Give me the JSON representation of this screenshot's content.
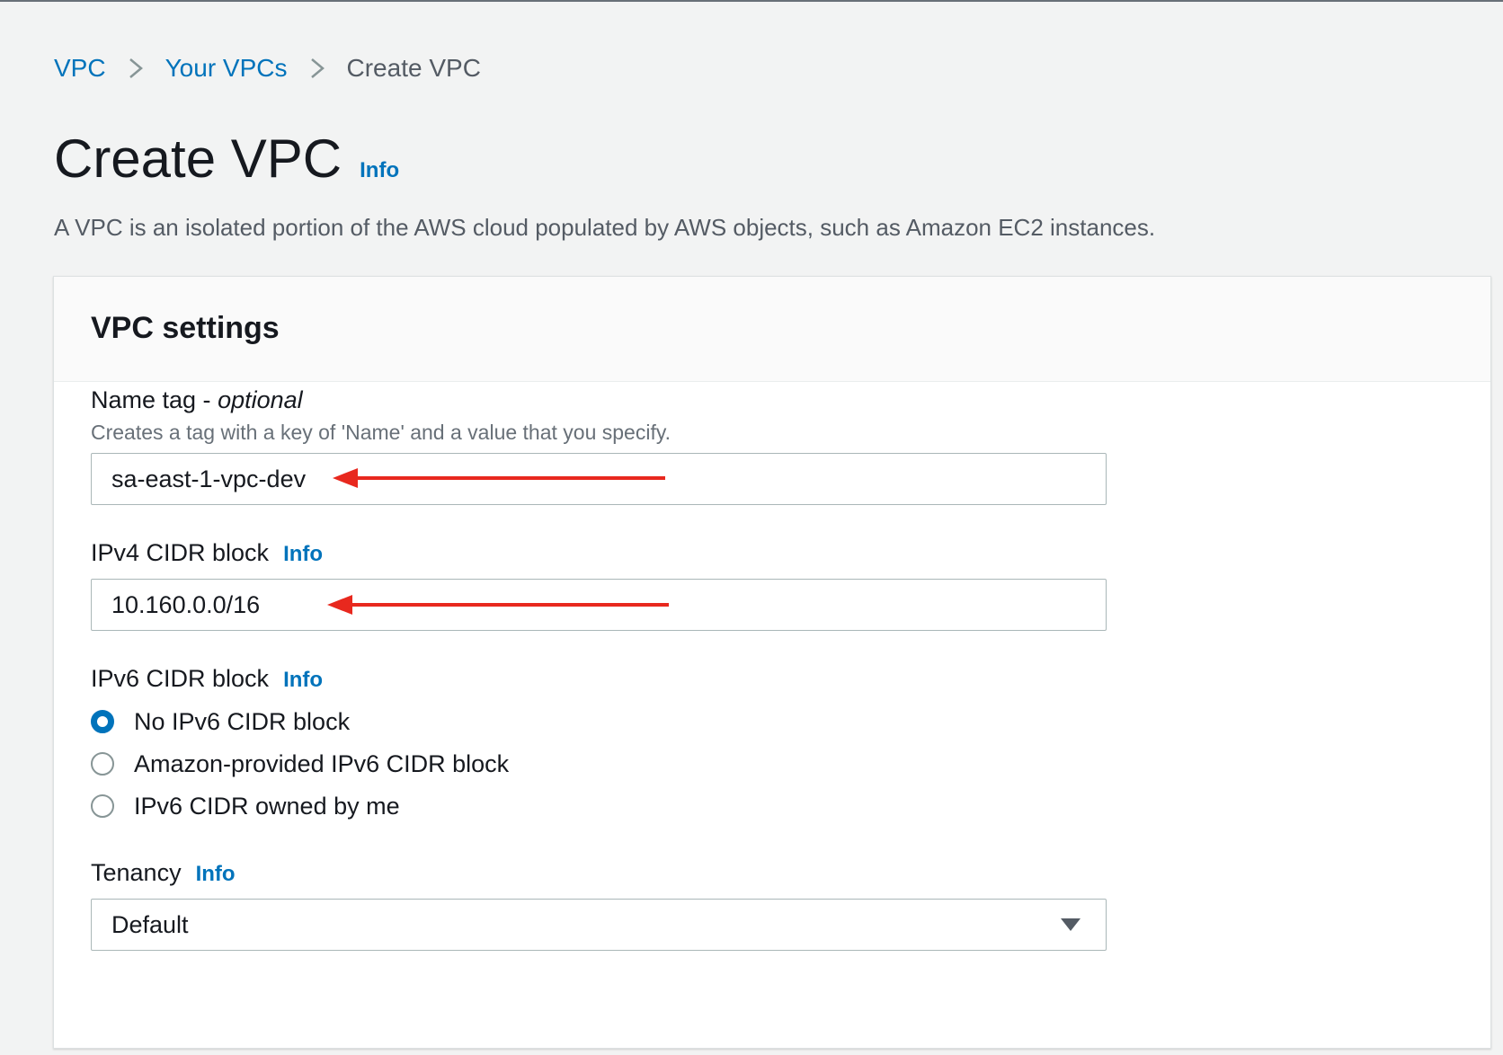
{
  "breadcrumb": {
    "items": [
      {
        "label": "VPC"
      },
      {
        "label": "Your VPCs"
      },
      {
        "label": "Create VPC"
      }
    ]
  },
  "header": {
    "title": "Create VPC",
    "info": "Info",
    "description": "A VPC is an isolated portion of the AWS cloud populated by AWS objects, such as Amazon EC2 instances."
  },
  "panel": {
    "title": "VPC settings",
    "name_tag": {
      "label": "Name tag - ",
      "label_optional": "optional",
      "description": "Creates a tag with a key of 'Name' and a value that you specify.",
      "value": "sa-east-1-vpc-dev"
    },
    "ipv4": {
      "label": "IPv4 CIDR block",
      "info": "Info",
      "value": "10.160.0.0/16"
    },
    "ipv6": {
      "label": "IPv6 CIDR block",
      "info": "Info",
      "options": [
        {
          "label": "No IPv6 CIDR block",
          "checked": true
        },
        {
          "label": "Amazon-provided IPv6 CIDR block",
          "checked": false
        },
        {
          "label": "IPv6 CIDR owned by me",
          "checked": false
        }
      ]
    },
    "tenancy": {
      "label": "Tenancy",
      "info": "Info",
      "selected": "Default"
    }
  },
  "colors": {
    "link": "#0073bb",
    "radio_selected": "#0073bb",
    "annotation_arrow": "#e8281e"
  },
  "icons": {
    "breadcrumb_separator": "chevron-right-icon",
    "select_caret": "caret-down-icon",
    "annotation": "red-arrow-annotation"
  }
}
